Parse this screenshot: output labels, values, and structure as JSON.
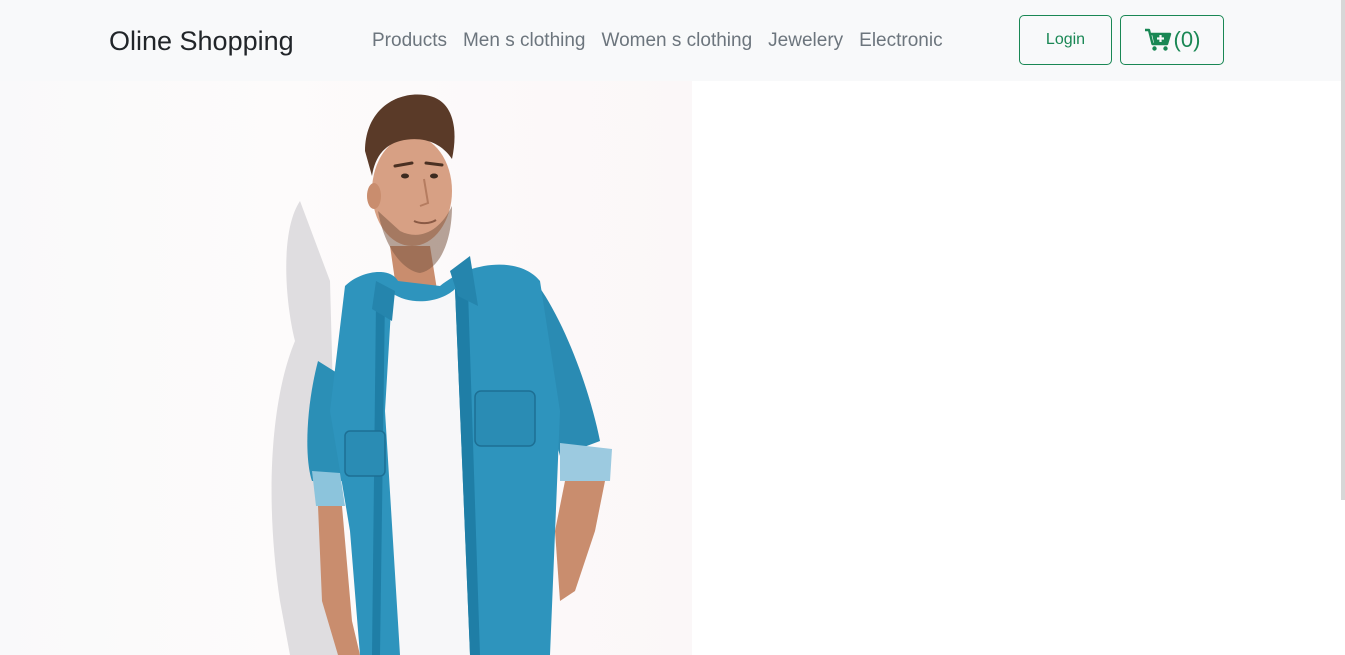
{
  "navbar": {
    "brand": "Oline Shopping",
    "links": [
      "Products",
      "Men s clothing",
      "Women s clothing",
      "Jewelery",
      "Electronic"
    ],
    "login_label": "Login",
    "cart_icon": "cart-plus-icon",
    "cart_count": "(0)"
  },
  "hero": {
    "image": "man-in-denim-shirt-photo"
  },
  "colors": {
    "accent": "#198754",
    "navbar_bg": "#f8f9fa",
    "link": "#6c757d",
    "brand": "#212529"
  }
}
